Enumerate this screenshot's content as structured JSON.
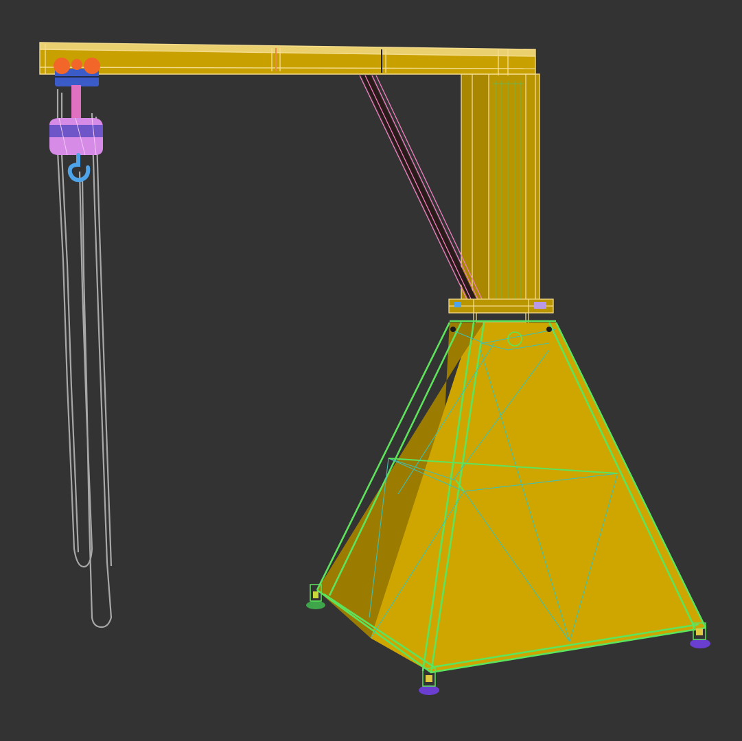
{
  "viewport": {
    "background": "#333333",
    "render_mode": "wireframe-over-shaded"
  },
  "scene": {
    "object": "jib-crane",
    "colors": {
      "base_fill": "#CFA600",
      "base_shadow": "#9C7C00",
      "base_wire": "#5EE35C",
      "base_wire_inner": "#3FC0B0",
      "boom_fill": "#C8A100",
      "boom_wire": "#F4DC8C",
      "column_fill": "#B99500",
      "column_wire": "#F0D690",
      "column_inner_wire": "#73B24A",
      "brace_fill": "#2A1A1A",
      "brace_wire": "#F080C0",
      "trolley": "#F2662A",
      "trolley_frame": "#3A5BC8",
      "hoist_body": "#D68CE6",
      "hoist_band": "#6E55C8",
      "hook": "#4FA3E8",
      "chain": "#A8A8A8",
      "foot_purple": "#6A3FD0",
      "foot_green": "#3FA54A"
    }
  }
}
